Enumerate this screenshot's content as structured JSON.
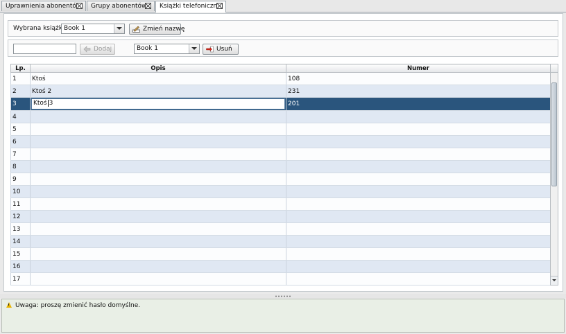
{
  "tabs": [
    {
      "label": "Uprawnienia abonentów"
    },
    {
      "label": "Grupy abonentów"
    },
    {
      "label": "Książki telefoniczne"
    }
  ],
  "book_selector": {
    "label": "Wybrana książka:",
    "selected": "Book 1",
    "rename_button": "Zmień nazwę"
  },
  "add_row": {
    "input_value": "",
    "add_button": "Dodaj",
    "book_select": "Book 1",
    "delete_button": "Usuń"
  },
  "grid": {
    "columns": {
      "lp": "Lp.",
      "opis": "Opis",
      "numer": "Numer"
    },
    "rows": [
      {
        "lp": "1",
        "opis": "Ktoś",
        "numer": "108"
      },
      {
        "lp": "2",
        "opis": "Ktoś 2",
        "numer": "231"
      },
      {
        "lp": "3",
        "opis_before": "Ktoś",
        "opis_after": "3",
        "numer": "201"
      },
      {
        "lp": "4",
        "opis": "",
        "numer": ""
      },
      {
        "lp": "5",
        "opis": "",
        "numer": ""
      },
      {
        "lp": "6",
        "opis": "",
        "numer": ""
      },
      {
        "lp": "7",
        "opis": "",
        "numer": ""
      },
      {
        "lp": "8",
        "opis": "",
        "numer": ""
      },
      {
        "lp": "9",
        "opis": "",
        "numer": ""
      },
      {
        "lp": "10",
        "opis": "",
        "numer": ""
      },
      {
        "lp": "11",
        "opis": "",
        "numer": ""
      },
      {
        "lp": "12",
        "opis": "",
        "numer": ""
      },
      {
        "lp": "13",
        "opis": "",
        "numer": ""
      },
      {
        "lp": "14",
        "opis": "",
        "numer": ""
      },
      {
        "lp": "15",
        "opis": "",
        "numer": ""
      },
      {
        "lp": "16",
        "opis": "",
        "numer": ""
      },
      {
        "lp": "17",
        "opis": "",
        "numer": ""
      }
    ]
  },
  "status": {
    "message": "Uwaga: proszę zmienić hasło domyślne."
  },
  "colors": {
    "selected_row": "#2a557d",
    "alt_row": "#e0e8f3",
    "status_bg": "#e9efe6"
  }
}
